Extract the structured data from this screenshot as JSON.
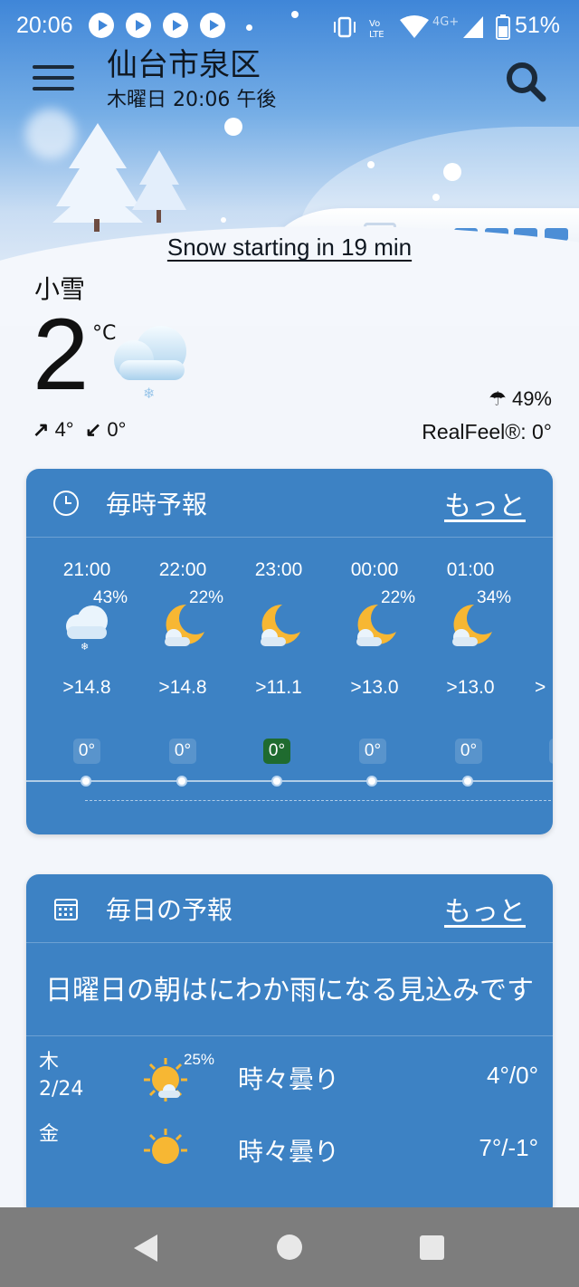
{
  "status_bar": {
    "time": "20:06",
    "battery": "51%"
  },
  "header": {
    "location": "仙台市泉区",
    "datetime": "木曜日 20:06 午後"
  },
  "alert": {
    "text": "Snow starting in 19 min"
  },
  "current": {
    "condition": "小雪",
    "temperature": "2",
    "unit": "°C",
    "high": "4°",
    "low": "0°",
    "precip": "49%",
    "realfeel": "RealFeel®: 0°"
  },
  "hourly_card": {
    "title": "毎時予報",
    "more": "もっと",
    "hours": [
      {
        "time": "21:00",
        "precip": "43%",
        "icon": "snow-cloud-icon",
        "wind": "14.8",
        "temp": "0°"
      },
      {
        "time": "22:00",
        "precip": "22%",
        "icon": "moon-cloud-icon",
        "wind": "14.8",
        "temp": "0°"
      },
      {
        "time": "23:00",
        "precip": "",
        "icon": "moon-cloud-icon",
        "wind": "11.1",
        "temp": "0°"
      },
      {
        "time": "00:00",
        "precip": "22%",
        "icon": "moon-cloud-icon",
        "wind": "13.0",
        "temp": "0°"
      },
      {
        "time": "01:00",
        "precip": "34%",
        "icon": "moon-cloud-icon",
        "wind": "13.0",
        "temp": "0°"
      }
    ]
  },
  "daily_card": {
    "title": "毎日の予報",
    "more": "もっと",
    "summary": "日曜日の朝はにわか雨になる見込みです",
    "days": [
      {
        "day": "木",
        "date": "2/24",
        "precip": "25%",
        "icon": "sun-cloud-icon",
        "condition": "時々曇り",
        "temps": "4°/0°"
      },
      {
        "day": "金",
        "date": "",
        "precip": "",
        "icon": "sun-icon",
        "condition": "時々曇り",
        "temps": "7°/-1°"
      }
    ]
  }
}
